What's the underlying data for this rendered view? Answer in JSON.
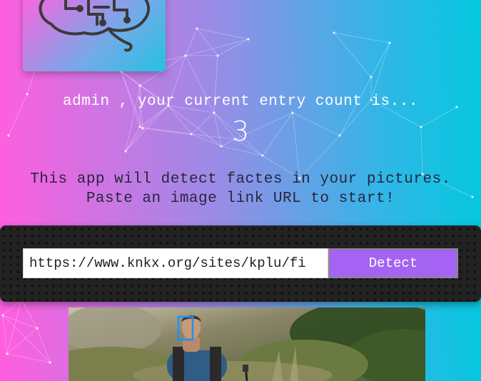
{
  "header": {
    "logo_icon": "brain-circuit-icon"
  },
  "status": {
    "user": "admin",
    "message_prefix": "admin , your current entry count is...",
    "entry_count": "3"
  },
  "intro": {
    "line1": "This app will detect factes in your pictures.",
    "line2": "Paste an image link URL to start!"
  },
  "form": {
    "url_value": "https://www.knkx.org/sites/kplu/fi",
    "detect_label": "Detect"
  },
  "result": {
    "face_box_color": "#1e90ff"
  },
  "colors": {
    "gradient_left": "#ff5edf",
    "gradient_right": "#04c8de",
    "button": "#a463f2",
    "panel": "#222222"
  }
}
